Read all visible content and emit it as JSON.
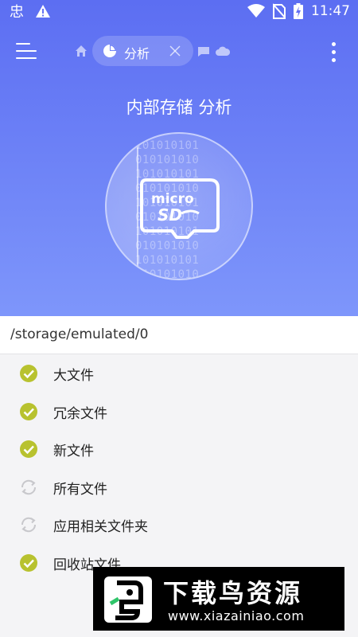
{
  "status_bar": {
    "time": "11:47",
    "left_icons": [
      "bug-notification-icon",
      "warning-icon"
    ],
    "right_icons": [
      "wifi-icon",
      "no-sim-icon",
      "battery-charging-icon"
    ]
  },
  "toolbar": {
    "tab_label": "分析"
  },
  "header": {
    "title": "内部存储 分析",
    "binary_text": "101010101\n010101010\n101010101\n010101010\n101010101\n010101010\n101010101\n010101010\n101010101\n010101010"
  },
  "path": "/storage/emulated/0",
  "items": [
    {
      "label": "大文件",
      "status": "done"
    },
    {
      "label": "冗余文件",
      "status": "done"
    },
    {
      "label": "新文件",
      "status": "done"
    },
    {
      "label": "所有文件",
      "status": "loading"
    },
    {
      "label": "应用相关文件夹",
      "status": "loading"
    },
    {
      "label": "回收站文件",
      "status": "done"
    }
  ],
  "watermark": {
    "title": "下载鸟资源",
    "url": "www.xiazainiao.com"
  },
  "colors": {
    "header_top": "#5c6ef2",
    "header_bottom": "#7e96fb",
    "check": "#b8c22f"
  }
}
